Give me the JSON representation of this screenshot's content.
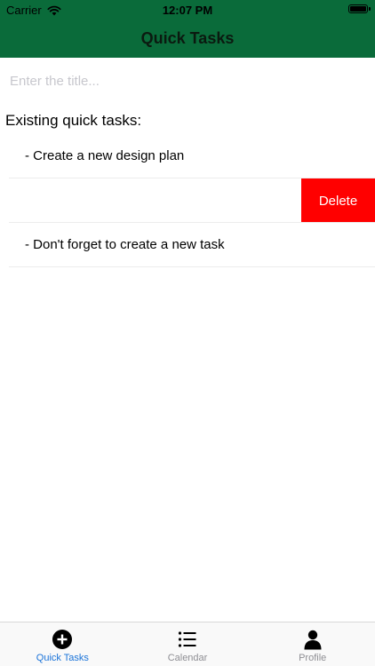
{
  "status_bar": {
    "carrier": "Carrier",
    "time": "12:07 PM",
    "battery_level": 1.0
  },
  "header": {
    "title": "Quick Tasks",
    "background": "#0a6b3a"
  },
  "title_input": {
    "value": "",
    "placeholder": "Enter the title..."
  },
  "tasks": {
    "heading": "Existing quick tasks:",
    "items": [
      {
        "text": "- Create a new design plan"
      },
      {
        "text": "",
        "delete_label": "Delete"
      },
      {
        "text": "- Don't forget to create a new task"
      }
    ],
    "delete_color": "#ff0000"
  },
  "tab_bar": {
    "active_color": "#1a73d9",
    "inactive_color": "#8e8e93",
    "tabs": [
      {
        "label": "Quick Tasks",
        "icon": "plus-circle-icon",
        "active": true
      },
      {
        "label": "Calendar",
        "icon": "list-icon",
        "active": false
      },
      {
        "label": "Profile",
        "icon": "person-icon",
        "active": false
      }
    ]
  }
}
